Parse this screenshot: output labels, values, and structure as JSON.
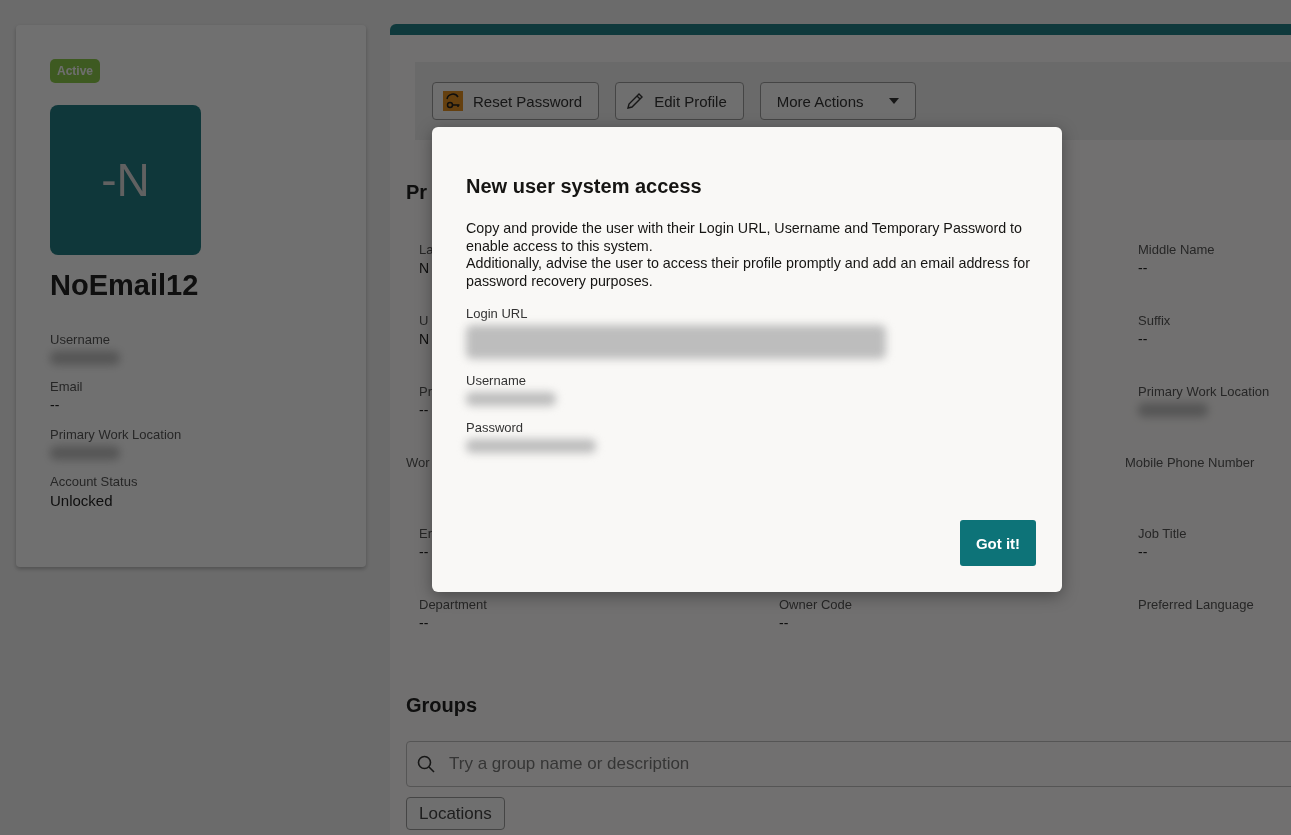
{
  "summary_card": {
    "status_badge": "Active",
    "avatar_initials": "-N",
    "display_name": "NoEmail12",
    "fields": [
      {
        "label": "Username",
        "blurred": true
      },
      {
        "label": "Email",
        "value": "--"
      },
      {
        "label": "Primary Work Location",
        "blurred": true
      },
      {
        "label": "Account Status",
        "value": "Unlocked",
        "emphasis": true
      }
    ]
  },
  "toolbar": {
    "buttons": [
      {
        "label": "Reset Password",
        "kind": "reset"
      },
      {
        "label": "Edit Profile",
        "kind": "edit"
      },
      {
        "label": "More Actions",
        "kind": "menu"
      }
    ]
  },
  "profile": {
    "heading": "Pr",
    "rows": [
      {
        "kind": "padded",
        "left": {
          "label": "La",
          "value": "N"
        },
        "right": {
          "label": "Middle Name",
          "value": "--"
        }
      },
      {
        "kind": "padded",
        "left": {
          "label": "U",
          "value": "N"
        },
        "right": {
          "label": "Suffix",
          "value": "--"
        }
      },
      {
        "kind": "padded",
        "left": {
          "label": "Pr",
          "value": "--"
        },
        "right": {
          "label": "Primary Work Location",
          "blurred": true
        }
      },
      {
        "kind": "flush",
        "left": {
          "label": "Wor"
        },
        "right": {
          "label": "Mobile Phone Number"
        }
      },
      {
        "kind": "padded",
        "left": {
          "label": "Er",
          "value": "--"
        },
        "right": {
          "label": "Job Title",
          "value": "--"
        }
      },
      {
        "kind": "padded",
        "left": {
          "label": "Department",
          "value": "--"
        },
        "middle": {
          "label": "Owner Code",
          "value": "--"
        },
        "right": {
          "label": "Preferred Language"
        }
      }
    ]
  },
  "groups": {
    "heading": "Groups",
    "search": {
      "placeholder": "Try a group name or description"
    },
    "chips": [
      "Locations"
    ]
  },
  "dialog": {
    "title": "New user system access",
    "paragraphs": [
      "Copy and provide the user with their Login URL, Username and Temporary Password to enable access to this system.",
      "Additionally, advise the user to access their profile promptly and add an email address for password recovery purposes."
    ],
    "fields": [
      {
        "label": "Login URL"
      },
      {
        "label": "Username"
      },
      {
        "label": "Password"
      }
    ],
    "button": "Got it!"
  }
}
